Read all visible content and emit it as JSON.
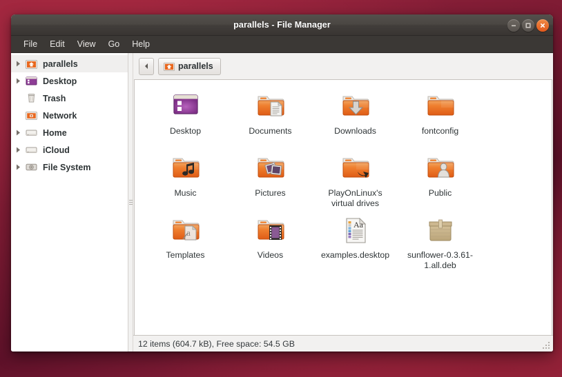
{
  "desktop": {
    "background_colors": [
      "#9c2641",
      "#7d1b33",
      "#5e1129",
      "#a62b42"
    ]
  },
  "window": {
    "title": "parallels - File Manager",
    "controls": {
      "minimize_label": "Minimize",
      "maximize_label": "Maximize",
      "close_label": "Close",
      "close_color": "#e2581b"
    }
  },
  "menubar": {
    "items": [
      {
        "label": "File"
      },
      {
        "label": "Edit"
      },
      {
        "label": "View"
      },
      {
        "label": "Go"
      },
      {
        "label": "Help"
      }
    ]
  },
  "sidebar": {
    "items": [
      {
        "label": "parallels",
        "icon": "home-folder-icon",
        "expandable": true,
        "selected": true
      },
      {
        "label": "Desktop",
        "icon": "desktop-icon",
        "expandable": true,
        "selected": false
      },
      {
        "label": "Trash",
        "icon": "trash-icon",
        "expandable": false,
        "selected": false
      },
      {
        "label": "Network",
        "icon": "network-icon",
        "expandable": false,
        "selected": false
      },
      {
        "label": "Home",
        "icon": "drive-icon",
        "expandable": true,
        "selected": false
      },
      {
        "label": "iCloud",
        "icon": "drive-icon",
        "expandable": true,
        "selected": false
      },
      {
        "label": "File System",
        "icon": "harddisk-icon",
        "expandable": true,
        "selected": false
      }
    ]
  },
  "pathbar": {
    "back_label": "Back",
    "breadcrumb": {
      "label": "parallels",
      "icon": "home-folder-icon"
    }
  },
  "files": [
    {
      "name": "Desktop",
      "icon": "desktop-folder-icon"
    },
    {
      "name": "Documents",
      "icon": "documents-folder-icon"
    },
    {
      "name": "Downloads",
      "icon": "downloads-folder-icon"
    },
    {
      "name": "fontconfig",
      "icon": "plain-folder-icon"
    },
    {
      "name": "Music",
      "icon": "music-folder-icon"
    },
    {
      "name": "Pictures",
      "icon": "pictures-folder-icon"
    },
    {
      "name": "PlayOnLinux's virtual drives",
      "icon": "symlink-folder-icon"
    },
    {
      "name": "Public",
      "icon": "public-folder-icon"
    },
    {
      "name": "Templates",
      "icon": "templates-folder-icon"
    },
    {
      "name": "Videos",
      "icon": "videos-folder-icon"
    },
    {
      "name": "examples.desktop",
      "icon": "text-document-icon"
    },
    {
      "name": "sunflower-0.3.61-1.all.deb",
      "icon": "deb-package-icon"
    }
  ],
  "statusbar": {
    "text": "12 items (604.7 kB), Free space: 54.5 GB",
    "item_count": 12,
    "total_size": "604.7 kB",
    "free_space": "54.5 GB"
  }
}
